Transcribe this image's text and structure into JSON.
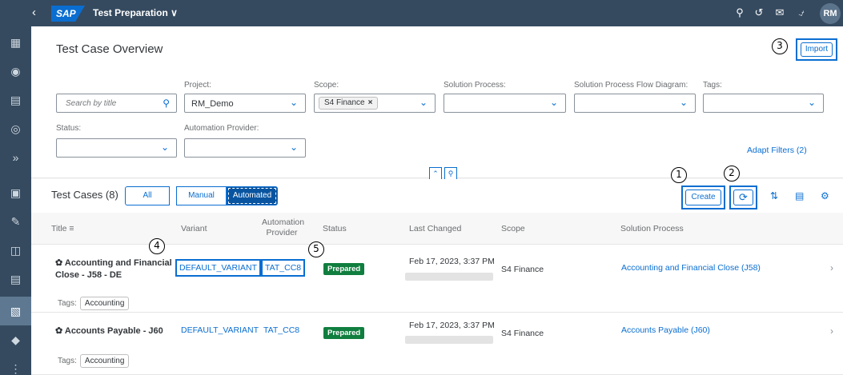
{
  "shell": {
    "logo": "SAP",
    "app_title": "Test Preparation ∨",
    "avatar": "RM"
  },
  "header": {
    "page_title": "Test Case Overview",
    "import_label": "Import",
    "adapt_filters": "Adapt Filters (2)"
  },
  "filters": {
    "search_placeholder": "Search by title",
    "project_label": "Project:",
    "project_value": "RM_Demo",
    "scope_label": "Scope:",
    "scope_token": "S4 Finance",
    "solution_process_label": "Solution Process:",
    "flow_diagram_label": "Solution Process Flow Diagram:",
    "tags_label": "Tags:",
    "status_label": "Status:",
    "automation_provider_label": "Automation Provider:"
  },
  "table": {
    "title": "Test Cases (8)",
    "segments": [
      "All",
      "Manual",
      "Automated"
    ],
    "selected_segment": "Automated",
    "create_label": "Create",
    "columns": {
      "title": "Title",
      "variant": "Variant",
      "automation_provider": "Automation Provider",
      "status": "Status",
      "last_changed": "Last Changed",
      "scope": "Scope",
      "solution_process": "Solution Process"
    },
    "rows": [
      {
        "title": "Accounting and Financial Close - J58 - DE",
        "variant": "DEFAULT_VARIANT",
        "provider": "TAT_CC8",
        "status": "Prepared",
        "last_changed": "Feb 17, 2023, 3:37 PM",
        "scope": "S4 Finance",
        "solution_process": "Accounting and Financial Close (J58)",
        "tags_label": "Tags:",
        "tag": "Accounting"
      },
      {
        "title": "Accounts Payable - J60",
        "variant": "DEFAULT_VARIANT",
        "provider": "TAT_CC8",
        "status": "Prepared",
        "last_changed": "Feb 17, 2023, 3:37 PM",
        "scope": "S4 Finance",
        "solution_process": "Accounts Payable (J60)",
        "tags_label": "Tags:",
        "tag": "Accounting"
      }
    ]
  },
  "callouts": [
    "1",
    "2",
    "3",
    "4",
    "5"
  ],
  "icons": {
    "shell": [
      "back-icon",
      "search-icon",
      "help-icon",
      "feedback-icon",
      "notification-icon"
    ],
    "side_nav": [
      "apps-icon",
      "target-icon",
      "list-icon",
      "goal-icon",
      "forward-icon",
      "frame-icon",
      "edit-icon",
      "transport-icon",
      "document-icon",
      "test-case-icon",
      "shield-icon",
      "more-icon"
    ],
    "table_tools": [
      "refresh-icon",
      "sort-icon",
      "group-icon",
      "settings-icon"
    ]
  },
  "colors": {
    "shell": "#354a5f",
    "accent": "#0a6ed1",
    "status_prepared": "#107e3e"
  }
}
